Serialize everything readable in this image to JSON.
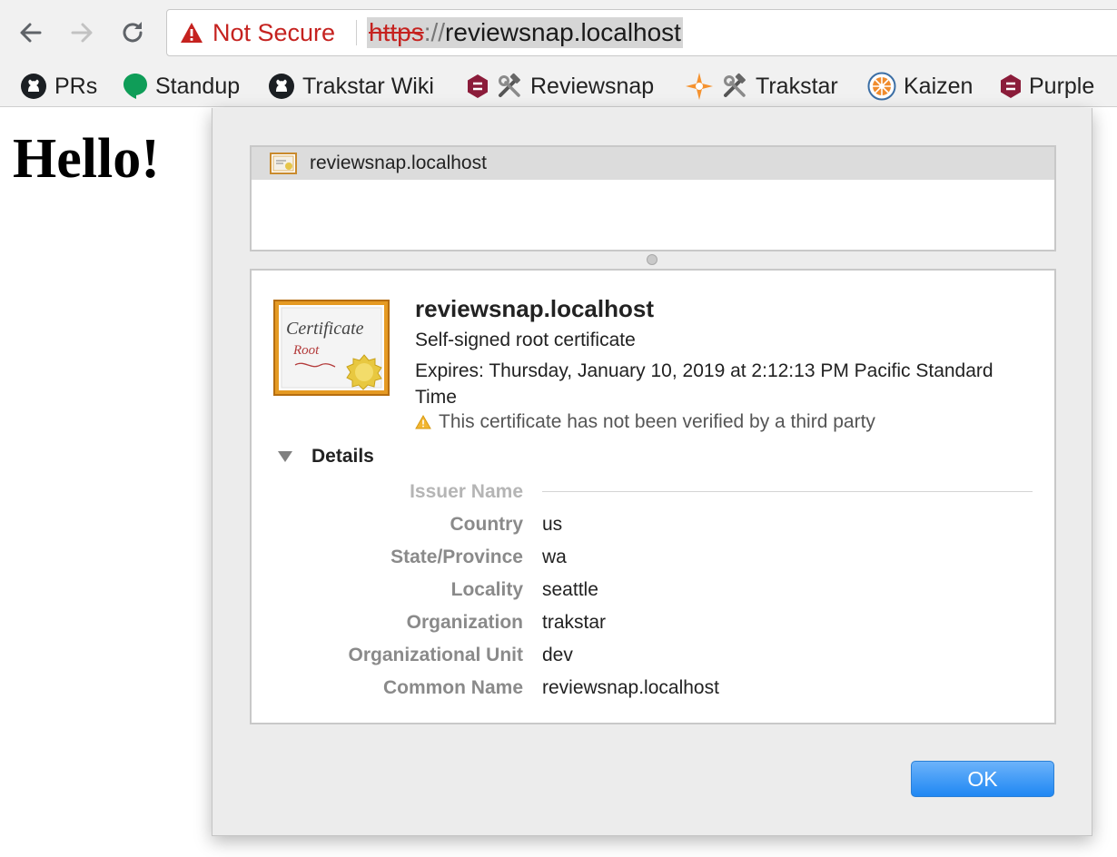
{
  "browser": {
    "security_text": "Not Secure",
    "url": {
      "scheme": "https",
      "separator": "://",
      "host": "reviewsnap.localhost"
    },
    "colors": {
      "insecure": "#c5221f",
      "toolbar_bg": "#f1f1f1"
    }
  },
  "bookmarks": [
    {
      "label": "PRs",
      "icon": "github-icon"
    },
    {
      "label": "Standup",
      "icon": "hangouts-icon"
    },
    {
      "label": "Trakstar Wiki",
      "icon": "github-icon"
    },
    {
      "label": "Reviewsnap",
      "icon": "hammer-and-wrench-icon"
    },
    {
      "label": "Trakstar",
      "icon": "hammer-and-wrench-icon"
    },
    {
      "label": "Kaizen",
      "icon": "kaizen-icon"
    },
    {
      "label": "Purple",
      "icon": "hexagon-icon"
    }
  ],
  "page": {
    "heading": "Hello!"
  },
  "certificate": {
    "list_item": "reviewsnap.localhost",
    "common_name_title": "reviewsnap.localhost",
    "type": "Self-signed root certificate",
    "expires": "Expires: Thursday, January 10, 2019 at 2:12:13 PM Pacific Standard Time",
    "warning": "This certificate has not been verified by a third party",
    "icon_text": {
      "title": "Certificate",
      "subtitle": "Root"
    },
    "details_label": "Details",
    "issuer_section": "Issuer Name",
    "fields": [
      {
        "label": "Country",
        "value": "us"
      },
      {
        "label": "State/Province",
        "value": "wa"
      },
      {
        "label": "Locality",
        "value": "seattle"
      },
      {
        "label": "Organization",
        "value": "trakstar"
      },
      {
        "label": "Organizational Unit",
        "value": "dev"
      },
      {
        "label": "Common Name",
        "value": "reviewsnap.localhost"
      }
    ],
    "ok_label": "OK"
  }
}
